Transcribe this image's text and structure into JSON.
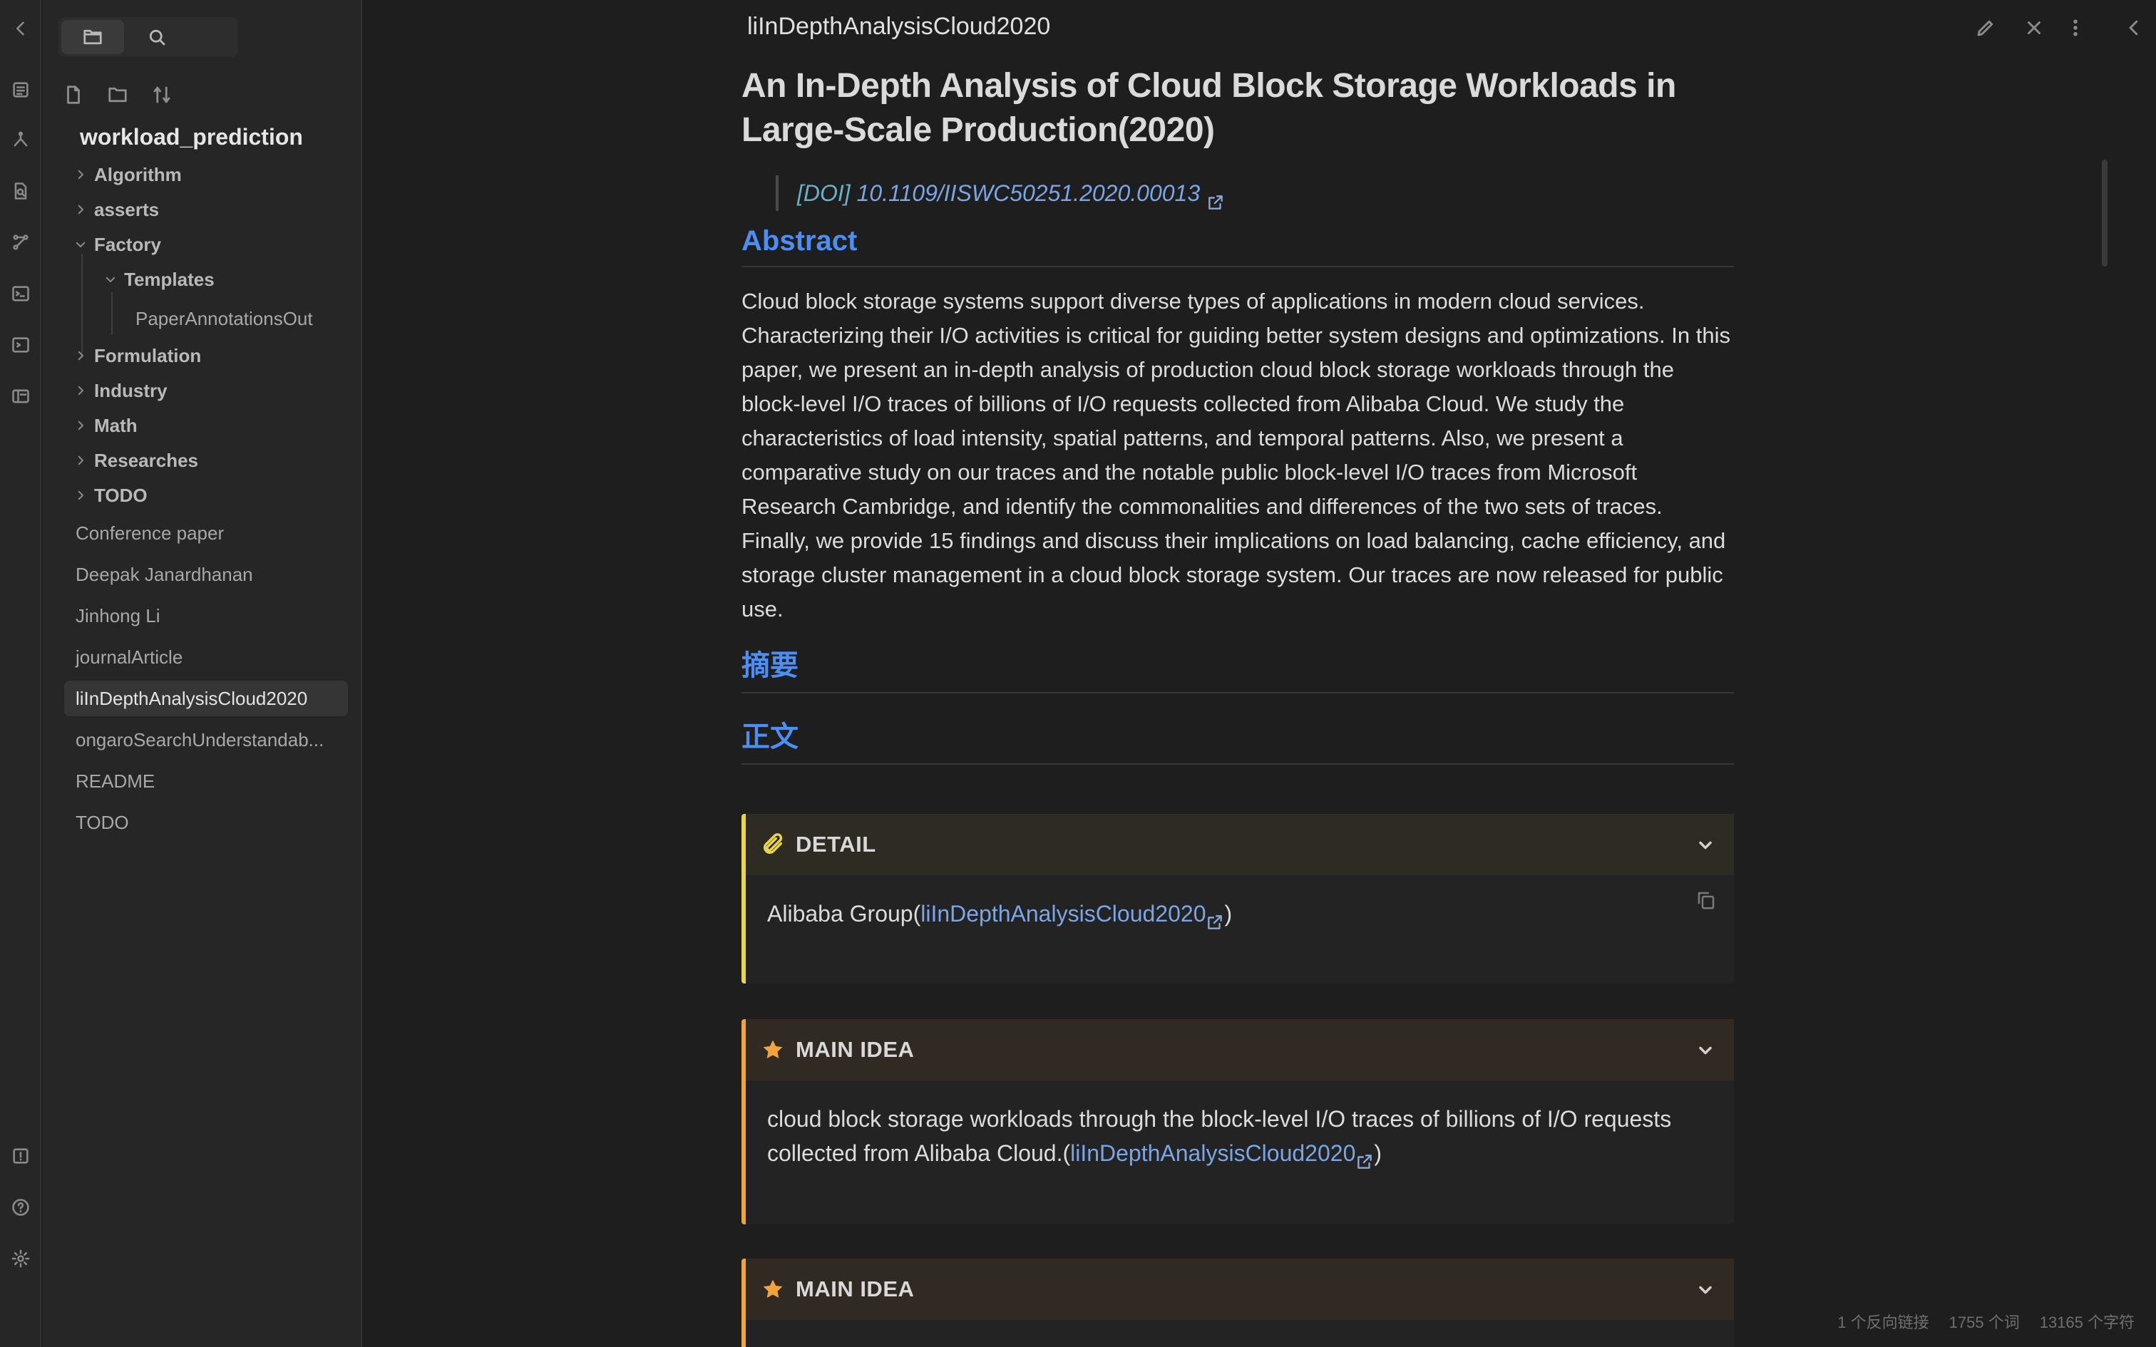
{
  "sidebar": {
    "vault_name": "workload_prediction",
    "folders": [
      {
        "label": "Algorithm"
      },
      {
        "label": "asserts"
      },
      {
        "label": "Factory"
      },
      {
        "label": "Templates"
      },
      {
        "label": "Formulation"
      },
      {
        "label": "Industry"
      },
      {
        "label": "Math"
      },
      {
        "label": "Researches"
      },
      {
        "label": "TODO"
      }
    ],
    "nested_file": "PaperAnnotationsOut",
    "files": [
      {
        "label": "Conference paper"
      },
      {
        "label": "Deepak Janardhanan"
      },
      {
        "label": "Jinhong Li"
      },
      {
        "label": "journalArticle"
      },
      {
        "label": "liInDepthAnalysisCloud2020"
      },
      {
        "label": "ongaroSearchUnderstandab..."
      },
      {
        "label": "README"
      },
      {
        "label": "TODO"
      }
    ]
  },
  "header": {
    "note_title": "liInDepthAnalysisCloud2020"
  },
  "note": {
    "title": "An In-Depth Analysis of Cloud Block Storage Workloads in Large-Scale Production(2020)",
    "doi_prefix": "[DOI]",
    "doi": "10.1109/IISWC50251.2020.00013",
    "abstract_heading": "Abstract",
    "abstract_text": "Cloud block storage systems support diverse types of applications in modern cloud services. Characterizing their I/O activities is critical for guiding better system designs and optimizations. In this paper, we present an in-depth analysis of production cloud block storage workloads through the block-level I/O traces of billions of I/O requests collected from Alibaba Cloud. We study the characteristics of load intensity, spatial patterns, and temporal patterns. Also, we present a comparative study on our traces and the notable public block-level I/O traces from Microsoft Research Cambridge, and identify the commonalities and differences of the two sets of traces. Finally, we provide 15 findings and discuss their implications on load balancing, cache efficiency, and storage cluster management in a cloud block storage system. Our traces are now released for public use.",
    "summary_heading": "摘要",
    "body_heading": "正文",
    "callouts": [
      {
        "title": "DETAIL",
        "text_before": "Alibaba Group(",
        "link": "liInDepthAnalysisCloud2020",
        "text_after": ")",
        "color": "#e8d44d"
      },
      {
        "title": "MAIN IDEA",
        "text_before": "cloud block storage workloads through the block-level I/O traces of billions of I/O requests collected from Alibaba Cloud.(",
        "link": "liInDepthAnalysisCloud2020",
        "text_after": ")",
        "color": "#f0a43a"
      },
      {
        "title": "MAIN IDEA",
        "color": "#f0a43a"
      }
    ]
  },
  "status_bar": {
    "backlinks": "1 个反向链接",
    "words": "1755 个词",
    "chars": "13165 个字符"
  }
}
